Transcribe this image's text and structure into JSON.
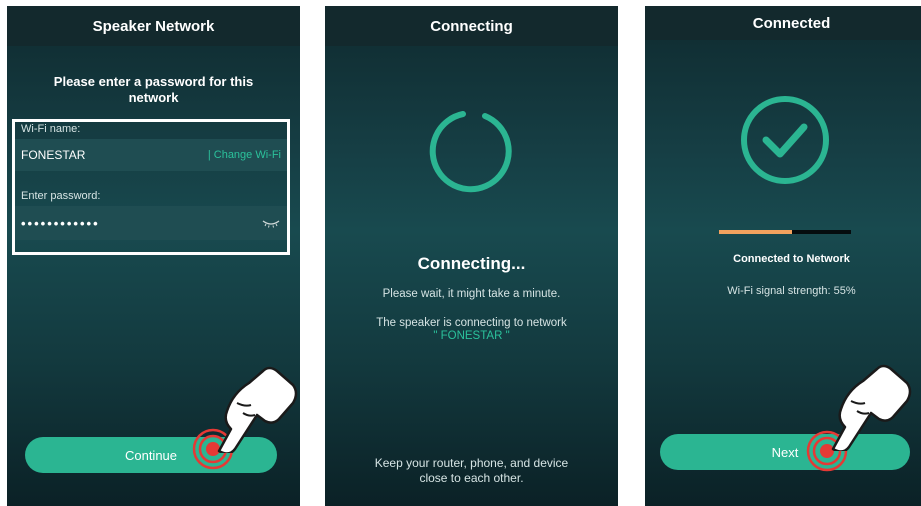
{
  "screen1": {
    "title": "Speaker Network",
    "prompt": "Please enter a password for this network",
    "wifi_label": "Wi-Fi name:",
    "wifi_name": "FONESTAR",
    "change_wifi": "| Change Wi-Fi",
    "password_label": "Enter password:",
    "password_value": "••••••••••••",
    "continue_label": "Continue",
    "icons": {
      "eye": "hidden-password-eye-icon",
      "hand": "pointing-hand-icon"
    }
  },
  "screen2": {
    "title": "Connecting",
    "heading": "Connecting...",
    "wait_text": "Please wait, it might take a minute.",
    "speaker_text": "The speaker is connecting to network",
    "network_quoted": "\" FONESTAR \"",
    "keep_text": "Keep your router, phone, and device close to each other.",
    "icons": {
      "spinner": "loading-spinner-icon"
    }
  },
  "screen3": {
    "title": "Connected",
    "progress": 0.55,
    "status": "Connected to Network",
    "signal": "Wi-Fi signal strength: 55%",
    "next_label": "Next",
    "icons": {
      "check": "check-circle-icon",
      "hand": "pointing-hand-icon"
    }
  },
  "colors": {
    "accent": "#2bb592",
    "accent_text": "#2bc19b",
    "progress_fill": "#f2a25e",
    "header_bg": "#13292d",
    "tap_ring": "#e53935"
  }
}
